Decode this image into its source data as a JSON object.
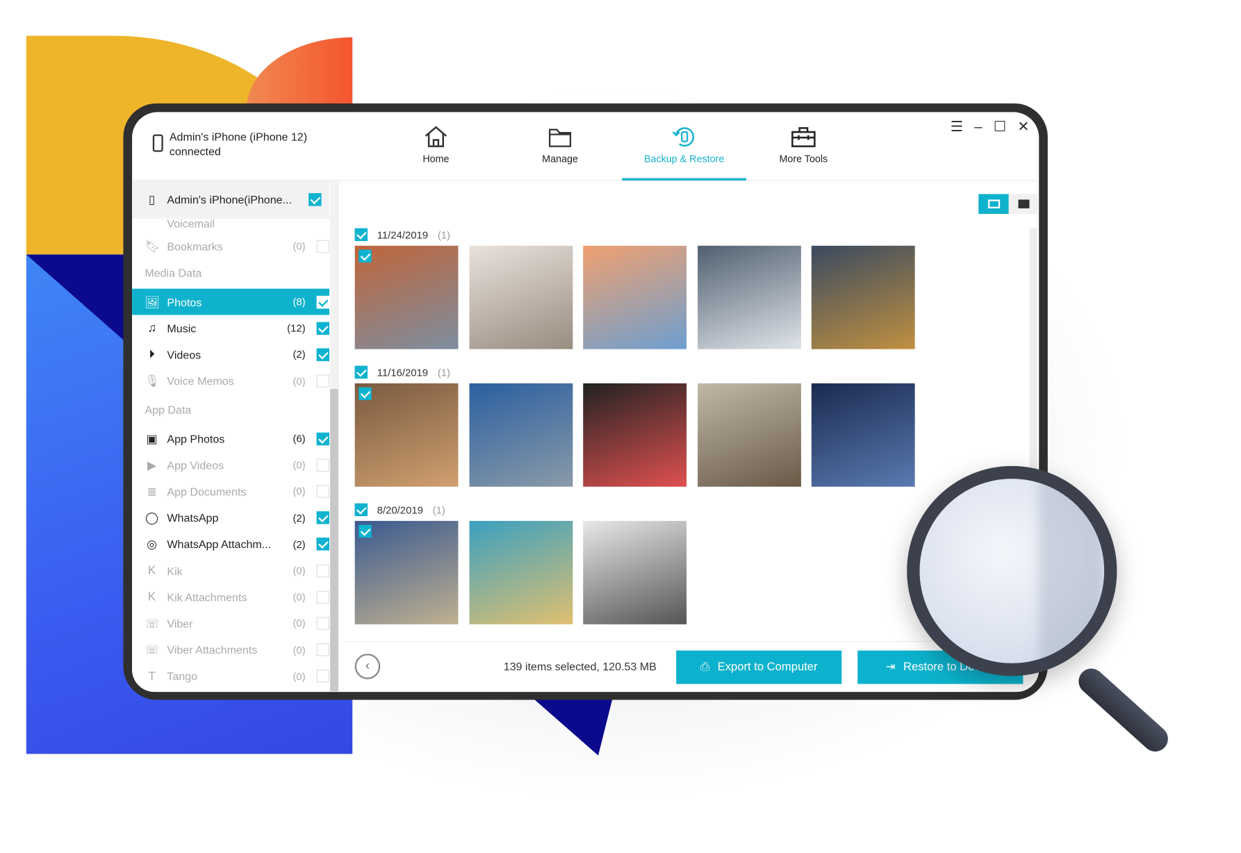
{
  "colors": {
    "accent": "#0fb2cd",
    "yellow": "#efb52a",
    "orange": "#f4552e",
    "blue": "#3b5cf0",
    "navy": "#0b0a8d",
    "frame": "#2f2f2f"
  },
  "device": {
    "name": "Admin's iPhone (iPhone 12)",
    "status": "connected"
  },
  "tabs": [
    {
      "label": "Home",
      "icon": "home-icon"
    },
    {
      "label": "Manage",
      "icon": "folder-icon"
    },
    {
      "label": "Backup & Restore",
      "icon": "backup-restore-icon",
      "active": true
    },
    {
      "label": "More Tools",
      "icon": "toolbox-icon"
    }
  ],
  "window_controls": [
    "menu-icon",
    "minimize-icon",
    "maximize-icon",
    "close-icon"
  ],
  "sidebar": {
    "device_row": {
      "label": "Admin's iPhone(iPhone...",
      "checked": true
    },
    "partial_row": {
      "label": "Voicemail",
      "count": "(0)"
    },
    "bookmarks": {
      "label": "Bookmarks",
      "count": "(0)",
      "checked": false
    },
    "media_section": "Media Data",
    "media": [
      {
        "label": "Photos",
        "count": "(8)",
        "checked": true,
        "selected": true,
        "icon": "image-icon"
      },
      {
        "label": "Music",
        "count": "(12)",
        "checked": true,
        "icon": "music-icon"
      },
      {
        "label": "Videos",
        "count": "(2)",
        "checked": true,
        "icon": "play-circle-icon"
      },
      {
        "label": "Voice Memos",
        "count": "(0)",
        "checked": false,
        "icon": "microphone-icon"
      }
    ],
    "app_section": "App Data",
    "apps": [
      {
        "label": "App Photos",
        "count": "(6)",
        "checked": true,
        "icon": "app-photo-icon"
      },
      {
        "label": "App Videos",
        "count": "(0)",
        "checked": false,
        "icon": "app-video-icon"
      },
      {
        "label": "App Documents",
        "count": "(0)",
        "checked": false,
        "icon": "document-icon"
      },
      {
        "label": "WhatsApp",
        "count": "(2)",
        "checked": true,
        "icon": "whatsapp-icon"
      },
      {
        "label": "WhatsApp Attachm...",
        "count": "(2)",
        "checked": true,
        "icon": "whatsapp-attachment-icon"
      },
      {
        "label": "Kik",
        "count": "(0)",
        "checked": false,
        "icon": "kik-icon"
      },
      {
        "label": "Kik Attachments",
        "count": "(0)",
        "checked": false,
        "icon": "kik-attachment-icon"
      },
      {
        "label": "Viber",
        "count": "(0)",
        "checked": false,
        "icon": "viber-icon"
      },
      {
        "label": "Viber Attachments",
        "count": "(0)",
        "checked": false,
        "icon": "viber-attachment-icon"
      },
      {
        "label": "Tango",
        "count": "(0)",
        "checked": false,
        "icon": "tango-icon"
      }
    ]
  },
  "view_toggle": [
    "grid-view-icon",
    "list-view-icon"
  ],
  "groups": [
    {
      "date": "11/24/2019",
      "count": "(1)",
      "photos": [
        "autumn basketball court",
        "white kitten",
        "clouds at sunset",
        "surfer on wave",
        "cat on rocks by sea"
      ]
    },
    {
      "date": "11/16/2019",
      "count": "(1)",
      "photos": [
        "food on table",
        "skyscraper construction",
        "light trails city",
        "woman at desk",
        "office building at night"
      ]
    },
    {
      "date": "8/20/2019",
      "count": "(1)",
      "photos": [
        "narrow street",
        "spiral staircase",
        "man at computer"
      ]
    }
  ],
  "footer": {
    "summary": "139 items selected, 120.53 MB",
    "export_label": "Export to Computer",
    "restore_label": "Restore to Device"
  }
}
